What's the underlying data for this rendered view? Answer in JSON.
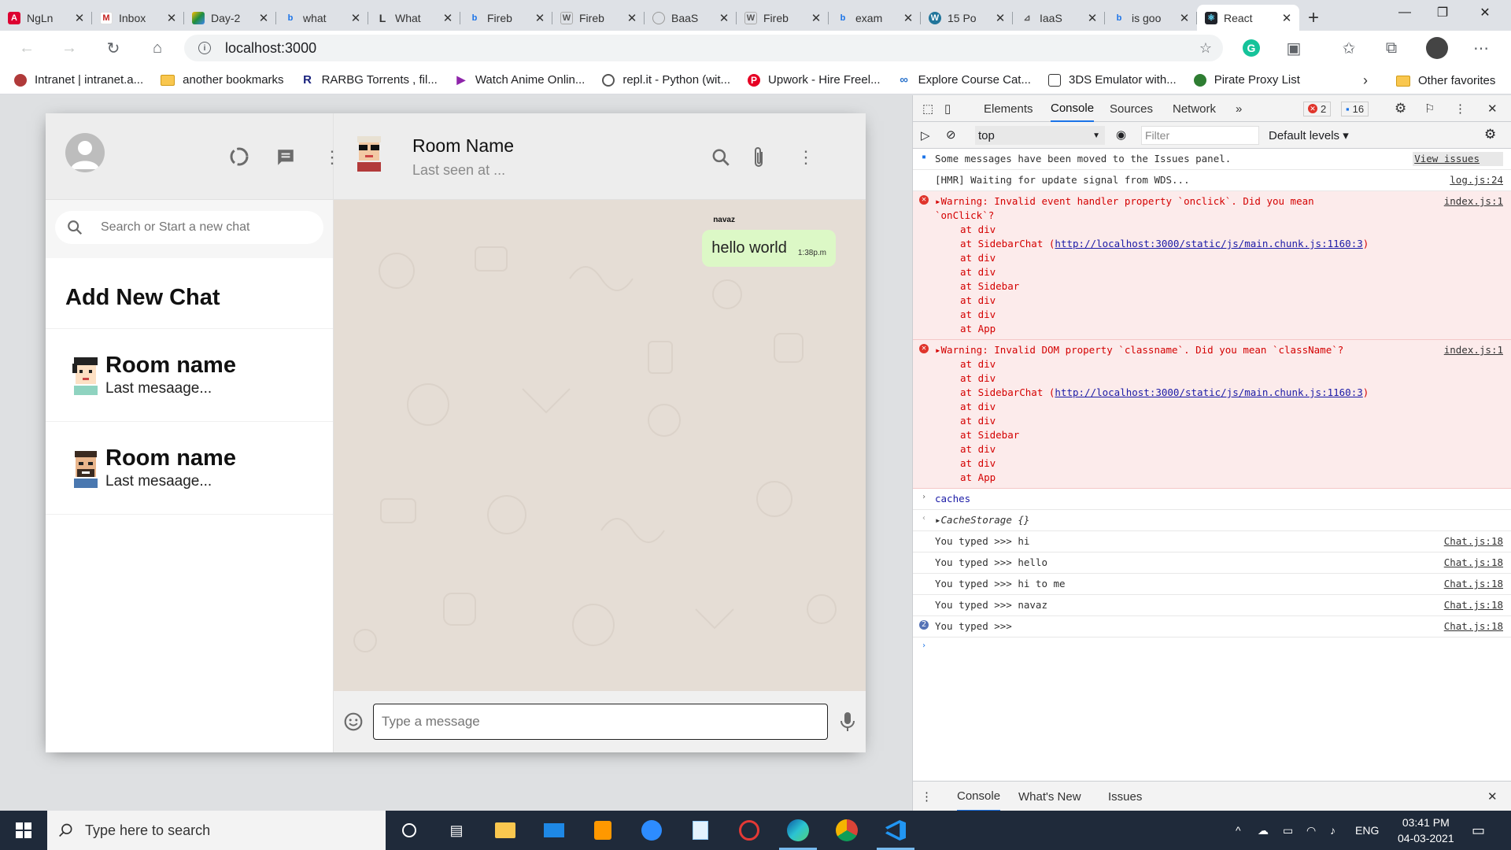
{
  "browser": {
    "tabs": [
      {
        "title": "NgLn",
        "icon": "angular-icon",
        "color": "#dd0031"
      },
      {
        "title": "Inbox",
        "icon": "gmail-icon",
        "color": "#c5221f"
      },
      {
        "title": "Day-2",
        "icon": "drive-icon",
        "color": "#1e8e3e"
      },
      {
        "title": "what",
        "icon": "bing-icon",
        "color": "#1a73e8"
      },
      {
        "title": "What",
        "icon": "L-icon",
        "color": "#333333"
      },
      {
        "title": "Fireb",
        "icon": "bing-icon",
        "color": "#1a73e8"
      },
      {
        "title": "Fireb",
        "icon": "wikipedia-icon",
        "color": "#555555"
      },
      {
        "title": "BaaS",
        "icon": "globe-icon",
        "color": "#777777"
      },
      {
        "title": "Fireb",
        "icon": "wikipedia-icon",
        "color": "#555555"
      },
      {
        "title": "exam",
        "icon": "bing-icon",
        "color": "#1a73e8"
      },
      {
        "title": "15 Po",
        "icon": "wordpress-icon",
        "color": "#21759b"
      },
      {
        "title": "IaaS",
        "icon": "chart-icon",
        "color": "#555555"
      },
      {
        "title": "is goo",
        "icon": "bing-icon",
        "color": "#1a73e8"
      },
      {
        "title": "React",
        "icon": "react-icon",
        "color": "#20232a",
        "active": true
      }
    ],
    "address": "localhost:3000",
    "bookmarks": [
      {
        "label": "Intranet | intranet.a...",
        "icon": "intranet-icon",
        "color": "#b03a3a"
      },
      {
        "label": "another bookmarks",
        "icon": "folder-icon",
        "color": "#f9c74f"
      },
      {
        "label": "RARBG Torrents , fil...",
        "icon": "R-icon",
        "color": "#1a237e"
      },
      {
        "label": "Watch Anime Onlin...",
        "icon": "play-icon",
        "color": "#8e24aa"
      },
      {
        "label": "repl.it - Python (wit...",
        "icon": "replit-icon",
        "color": "#555555"
      },
      {
        "label": "Upwork - Hire Freel...",
        "icon": "pinterest-icon",
        "color": "#e60023"
      },
      {
        "label": "Explore Course Cat...",
        "icon": "coursera-icon",
        "color": "#2a73cc"
      },
      {
        "label": "3DS Emulator with...",
        "icon": "emulator-icon",
        "color": "#333333"
      },
      {
        "label": "Pirate Proxy List",
        "icon": "pirate-icon",
        "color": "#2e7d32"
      }
    ],
    "other_favorites": "Other favorites"
  },
  "app": {
    "search_placeholder": "Search or Start a new chat",
    "add_new_chat": "Add New Chat",
    "rooms": [
      {
        "name": "Room name",
        "last": "Last mesaage..."
      },
      {
        "name": "Room name",
        "last": "Last mesaage..."
      }
    ],
    "chat": {
      "room_name": "Room Name",
      "last_seen": "Last seen at ...",
      "message": {
        "sender": "navaz",
        "text": "hello world",
        "time": "1:38p.m"
      },
      "input_placeholder": "Type a message"
    }
  },
  "devtools": {
    "tabs": [
      "Elements",
      "Console",
      "Sources",
      "Network"
    ],
    "active_tab": "Console",
    "error_count": "2",
    "message_count": "16",
    "context": "top",
    "filter_placeholder": "Filter",
    "levels": "Default levels",
    "console": {
      "issues_msg": "Some messages have been moved to the Issues panel.",
      "view_issues": "View issues",
      "hmr_msg": "[HMR] Waiting for update signal from WDS...",
      "hmr_src": "log.js:24",
      "warn1": "Warning: Invalid event handler property `onclick`. Did you mean\n`onClick`?",
      "warn1_src": "index.js:1",
      "warn1_stack_a": "at div\nat SidebarChat (",
      "chunk_link": "http://localhost:3000/static/js/main.chunk.js:1160:3",
      "warn1_stack_b": "at div\nat div\nat Sidebar\nat div\nat div\nat App",
      "warn2": "Warning: Invalid DOM property `classname`. Did you mean `className`?",
      "warn2_src": "index.js:1",
      "warn2_stack_a": "at div\nat div\nat SidebarChat (",
      "warn2_stack_b": "at div\nat div\nat Sidebar\nat div\nat div\nat App",
      "eval_input": "caches",
      "eval_result": "CacheStorage {}",
      "logs": [
        {
          "text": "You typed >>> hi",
          "src": "Chat.js:18"
        },
        {
          "text": "You typed >>> hello",
          "src": "Chat.js:18"
        },
        {
          "text": "You typed >>> hi to me",
          "src": "Chat.js:18"
        },
        {
          "text": "You typed >>> navaz",
          "src": "Chat.js:18"
        }
      ],
      "repeat_count": "2",
      "repeat_text": "You typed >>>",
      "repeat_src": "Chat.js:18"
    },
    "drawer_tabs": [
      "Console",
      "What's New",
      "Issues"
    ]
  },
  "taskbar": {
    "search_placeholder": "Type here to search",
    "lang": "ENG",
    "time": "03:41 PM",
    "date": "04-03-2021"
  }
}
